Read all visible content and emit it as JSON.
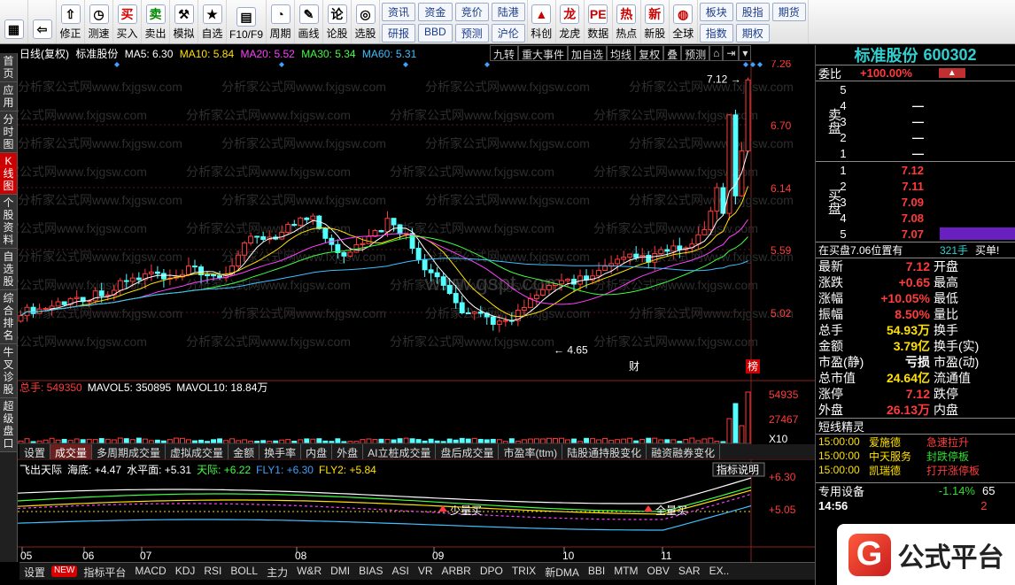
{
  "toolbar": {
    "left": [
      {
        "label": "",
        "icon": "windows-icon"
      },
      {
        "label": "",
        "icon": "back-arrow-icon"
      },
      {
        "label": "修正",
        "icon": "up-arrow-icon"
      },
      {
        "label": "测速",
        "icon": "clock-icon"
      },
      {
        "label": "买入",
        "icon": "buy-icon"
      },
      {
        "label": "卖出",
        "icon": "sell-icon"
      },
      {
        "label": "模拟",
        "icon": "hammer-icon"
      },
      {
        "label": "自选",
        "icon": "star-icon"
      },
      {
        "label": "F10/F9",
        "icon": "f10-icon"
      },
      {
        "label": "周期",
        "icon": "period-icon"
      },
      {
        "label": "画线",
        "icon": "pen-icon"
      },
      {
        "label": "论股",
        "icon": "discuss-icon"
      },
      {
        "label": "选股",
        "icon": "screen-icon"
      }
    ],
    "grid": [
      [
        "资讯",
        "研报"
      ],
      [
        "资金",
        "BBD"
      ],
      [
        "竞价",
        "预测"
      ],
      [
        "陆港",
        "沪伦"
      ]
    ],
    "right": [
      {
        "label": "科创",
        "icon": "sci-icon"
      },
      {
        "label": "龙虎",
        "icon": "dragon-icon"
      },
      {
        "label": "数据",
        "icon": "pe-icon"
      },
      {
        "label": "热点",
        "icon": "hot-icon"
      },
      {
        "label": "新股",
        "icon": "new-icon"
      },
      {
        "label": "全球",
        "icon": "globe-icon"
      }
    ],
    "grid2": [
      [
        "板块",
        "指数"
      ],
      [
        "股指",
        "期权"
      ],
      [
        "期货",
        ""
      ]
    ]
  },
  "sidetabs": [
    "首页",
    "应用",
    "分时图",
    "K线图",
    "个股资料",
    "自选股",
    "综合排名",
    "牛叉诊股",
    "超级盘口"
  ],
  "chart": {
    "line_label": "日线(复权)",
    "stock": "标准股份",
    "ma5": "MA5: 6.30",
    "ma10": "MA10: 5.84",
    "ma20": "MA20: 5.52",
    "ma30": "MA30: 5.34",
    "ma60": "MA60: 5.31",
    "high_label": "7.12",
    "low_label": "4.65",
    "cai": "财",
    "bang": "榜"
  },
  "tools": [
    "九转",
    "重大事件",
    "加自选",
    "均线",
    "复权",
    "叠",
    "预测"
  ],
  "price_axis": [
    "7.26",
    "6.70",
    "6.14",
    "5.59",
    "5.02"
  ],
  "vol_header": {
    "total": "总手: 549350",
    "mavol5": "MAVOL5: 350895",
    "mavol10": "MAVOL10: 18.84万"
  },
  "vol_axis": [
    "54935",
    "27467",
    "X10"
  ],
  "tabs": [
    "设置",
    "成交量",
    "多周期成交量",
    "虚拟成交量",
    "金额",
    "换手率",
    "内盘",
    "外盘",
    "AI立桩成交量",
    "盘后成交量",
    "市盈率(ttm)",
    "陆股通持股变化",
    "融资融券变化"
  ],
  "ind_explain": "指标说明",
  "ind_header": {
    "name": "飞出天际",
    "haidi": "海底: +4.47",
    "shuiping": "水平面: +5.31",
    "tianji": "天际: +6.22",
    "fly1": "FLY1: +6.30",
    "fly2": "FLY2: +5.84"
  },
  "ind_axis": [
    "+6.30",
    "+5.05"
  ],
  "signals": [
    "少量买",
    "全量买"
  ],
  "dates": [
    "05",
    "06",
    "07",
    "08",
    "09",
    "10",
    "11"
  ],
  "watermark": [
    "分析家公式网www.fxjgsw.com",
    "www.gspt.com"
  ],
  "indicators": [
    "设置",
    "NEW",
    "指标平台",
    "MACD",
    "KDJ",
    "RSI",
    "BOLL",
    "主力",
    "W&R",
    "DMI",
    "BIAS",
    "ASI",
    "VR",
    "ARBR",
    "DPO",
    "TRIX",
    "新DMA",
    "BBI",
    "MTM",
    "OBV",
    "SAR",
    "EX.."
  ],
  "quote": {
    "name": "标准股份",
    "code": "600302",
    "weibi_l": "委比",
    "weibi": "+100.00%",
    "sell": [
      [
        "5",
        ""
      ],
      [
        "4",
        "—"
      ],
      [
        "3",
        "—"
      ],
      [
        "2",
        "—"
      ],
      [
        "1",
        "—"
      ]
    ],
    "buy": [
      [
        "1",
        "7.12"
      ],
      [
        "2",
        "7.11"
      ],
      [
        "3",
        "7.09"
      ],
      [
        "4",
        "7.08"
      ],
      [
        "5",
        "7.07"
      ]
    ],
    "sell_label": "卖盘",
    "buy_label": "买盘",
    "buypos": "在买盘7.06位置有",
    "buypos_v": "321手",
    "buypos_t": "买单!",
    "stats": [
      [
        "最新",
        "7.12",
        "开盘",
        ""
      ],
      [
        "涨跌",
        "+0.65",
        "最高",
        ""
      ],
      [
        "涨幅",
        "+10.05%",
        "最低",
        ""
      ],
      [
        "振幅",
        "8.50%",
        "量比",
        ""
      ],
      [
        "总手",
        "54.93万",
        "换手",
        ""
      ],
      [
        "金额",
        "3.79亿",
        "换手(实)",
        ""
      ],
      [
        "市盈(静)",
        "亏损",
        "市盈(动)",
        ""
      ],
      [
        "总市值",
        "24.64亿",
        "流通值",
        ""
      ],
      [
        "涨停",
        "7.12",
        "跌停",
        ""
      ],
      [
        "外盘",
        "26.13万",
        "内盘",
        ""
      ]
    ],
    "jl_title": "短线精灵",
    "jl": [
      [
        "15:00:00",
        "爱施德",
        "急速拉升"
      ],
      [
        "15:00:00",
        "中天服务",
        "封跌停板"
      ],
      [
        "15:00:00",
        "凯瑞德",
        "打开涨停板"
      ]
    ],
    "zy_label": "专用设备",
    "zy_val": "-1.14%",
    "zy_v2": "65",
    "ts_time": "14:56",
    "ts_v": "2"
  },
  "logo_text": "公式平台",
  "chart_data": {
    "type": "candlestick",
    "ylim": [
      4.65,
      7.26
    ],
    "high": 7.12,
    "low": 4.65,
    "month_labels": [
      "05",
      "06",
      "07",
      "08",
      "09",
      "10",
      "11"
    ],
    "ma_latest": {
      "MA5": 6.3,
      "MA10": 5.84,
      "MA20": 5.52,
      "MA30": 5.34,
      "MA60": 5.31
    },
    "volume_axis": [
      54935,
      27467
    ]
  }
}
